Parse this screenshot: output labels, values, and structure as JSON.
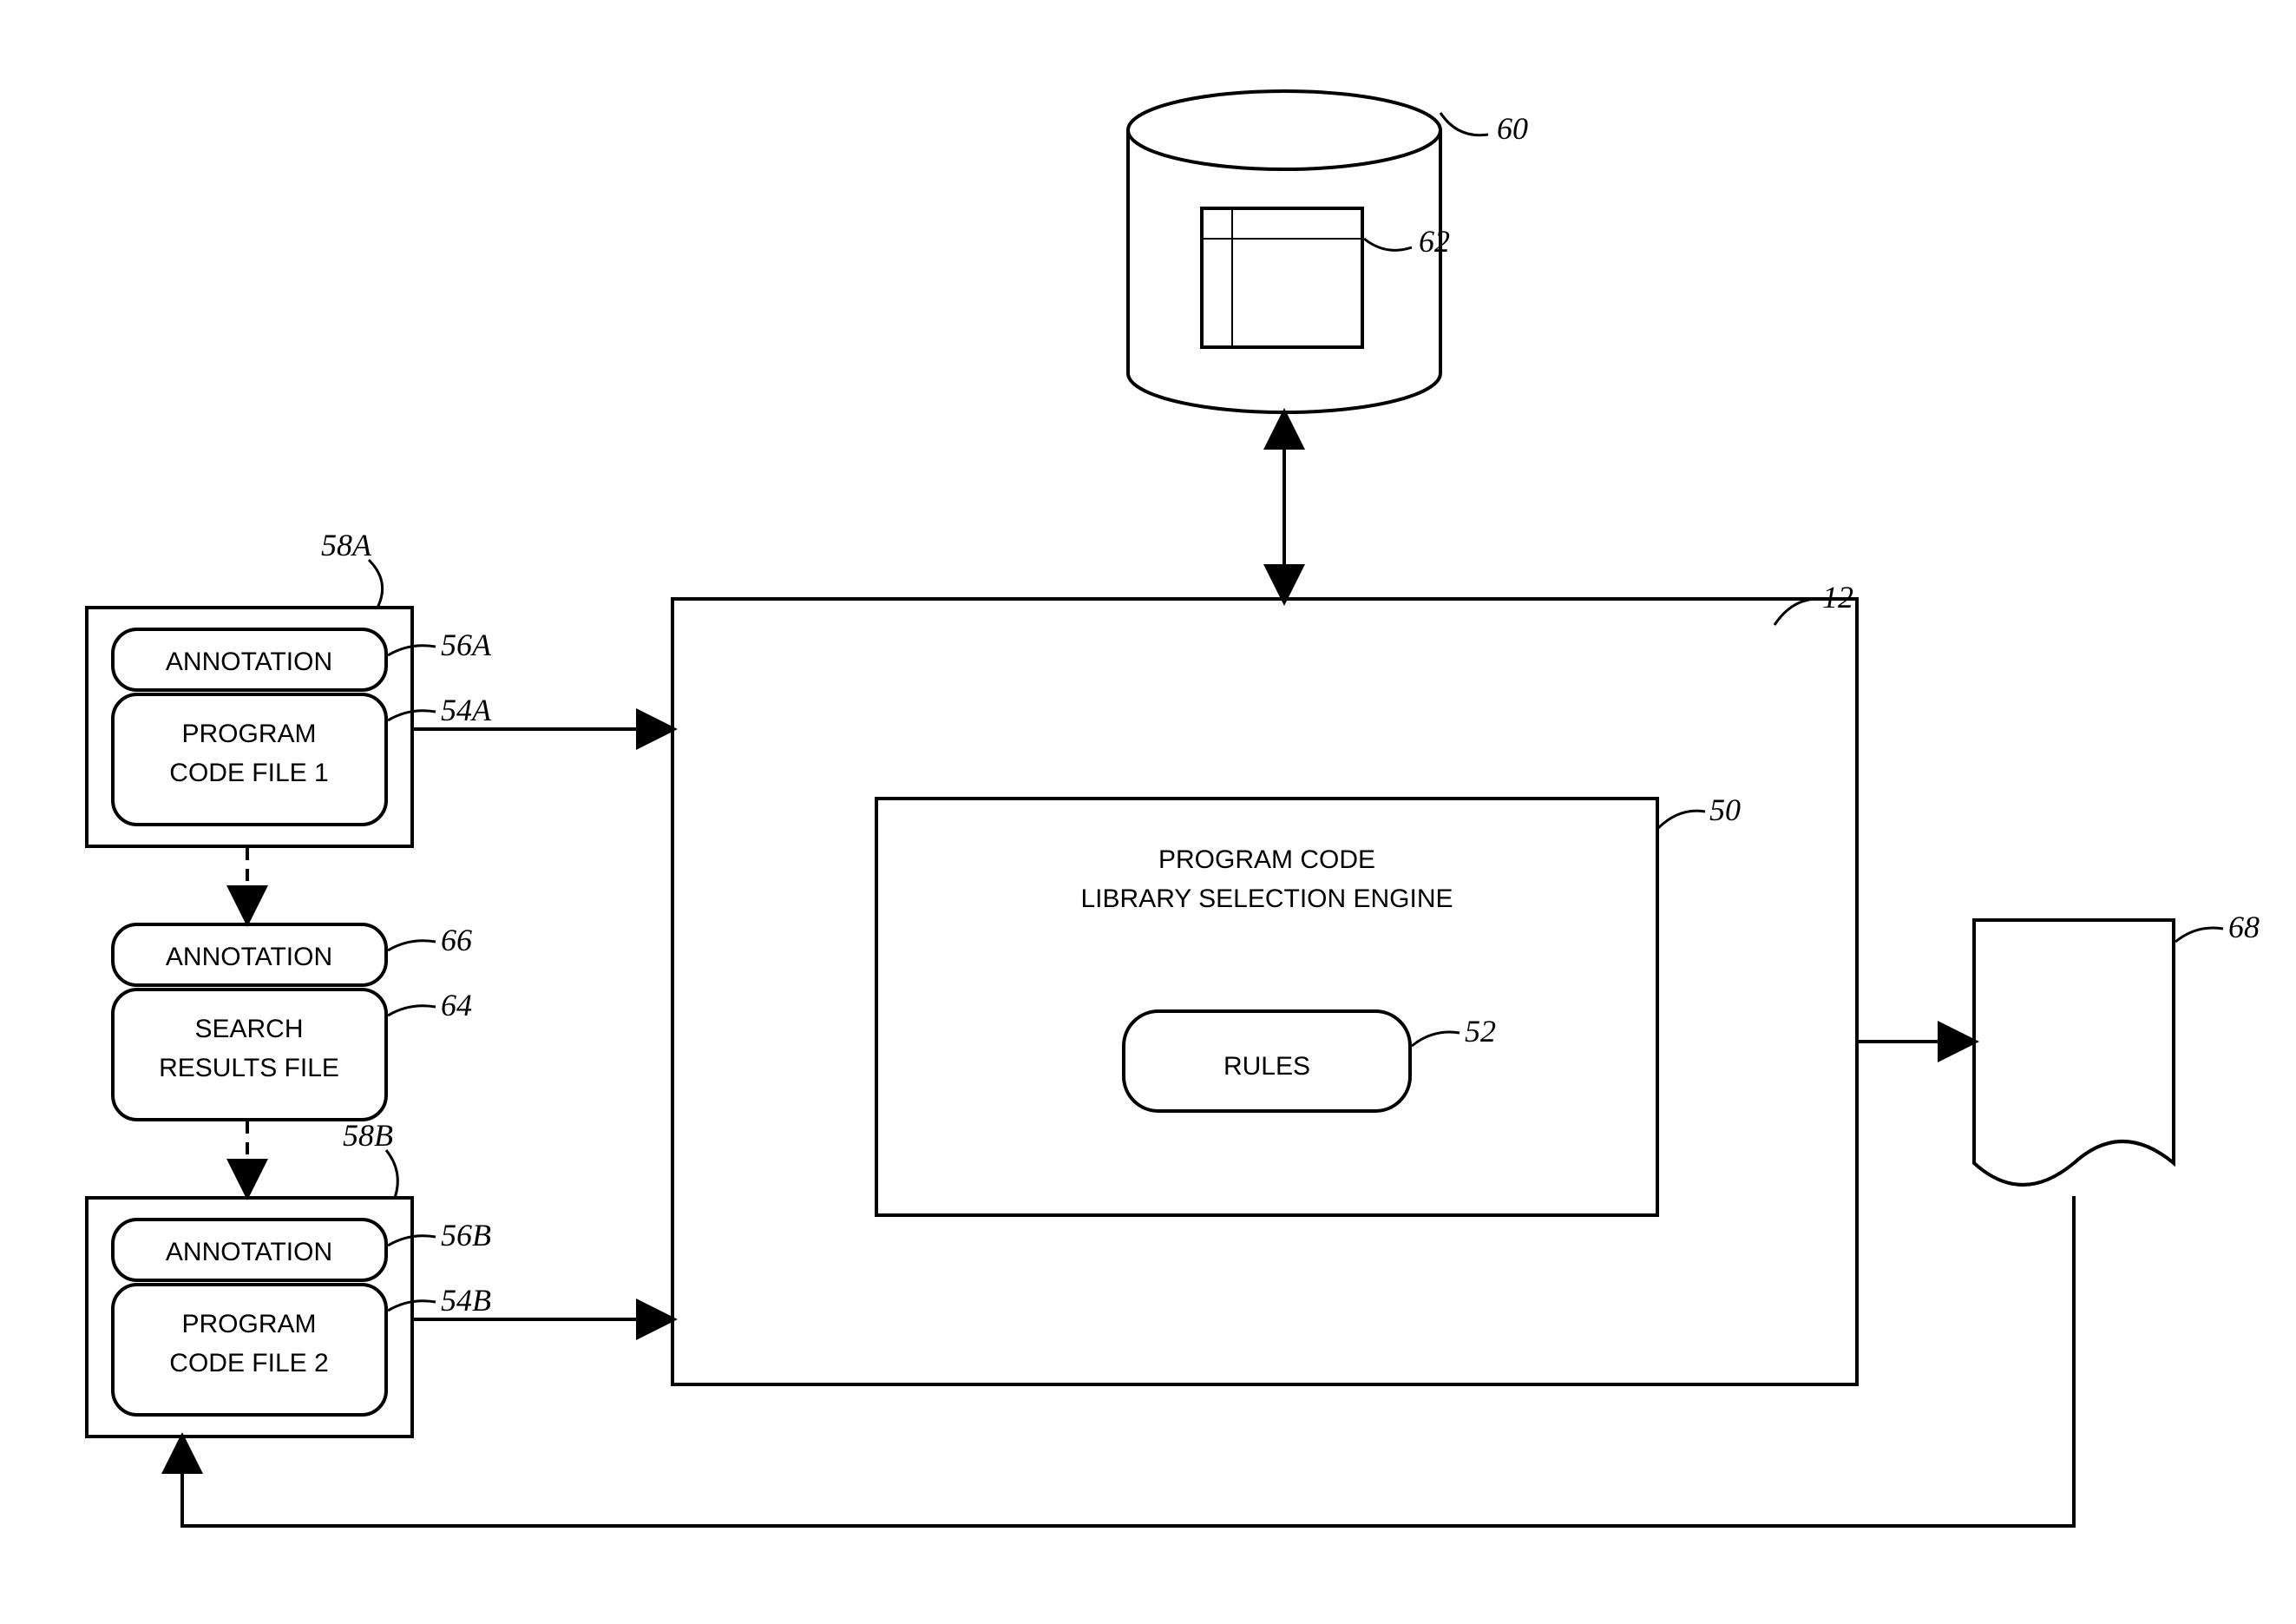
{
  "refs": {
    "r60": "60",
    "r62": "62",
    "r12": "12",
    "r50": "50",
    "r52": "52",
    "r58A": "58A",
    "r56A": "56A",
    "r54A": "54A",
    "r66": "66",
    "r64": "64",
    "r58B": "58B",
    "r56B": "56B",
    "r54B": "54B",
    "r68": "68"
  },
  "text": {
    "annotation": "ANNOTATION",
    "prog1a": "PROGRAM",
    "prog1b": "CODE FILE 1",
    "prog2a": "PROGRAM",
    "prog2b": "CODE FILE 2",
    "search1": "SEARCH",
    "search2": "RESULTS FILE",
    "engine1": "PROGRAM CODE",
    "engine2": "LIBRARY SELECTION ENGINE",
    "rules": "RULES"
  }
}
